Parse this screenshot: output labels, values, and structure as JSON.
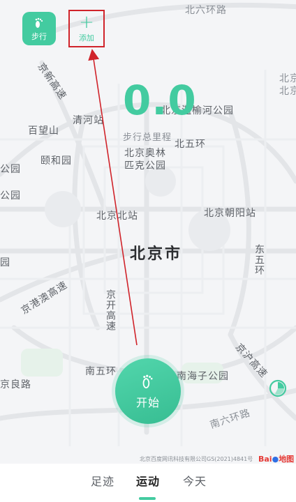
{
  "header": {
    "mode_label": "步行",
    "add_label": "添加"
  },
  "stats": {
    "distance": "0.0",
    "distance_label": "步行总里程"
  },
  "map": {
    "labels": {
      "north_6th_ring": "北六环路",
      "jingxin_expressway": "京新高速",
      "qinghe": "清河站",
      "baiwangshan": "百望山",
      "yiheyuan": "颐和园",
      "park_left1": "公园",
      "park_left2": "公园",
      "wenyu_park": "北京温榆河公园",
      "north_5th_ring": "北五环",
      "olympic_park_1": "北京奥林",
      "olympic_park_2": "匹克公园",
      "beijing_north_station": "北京北站",
      "chaoyang_station": "北京朝阳站",
      "city": "北京市",
      "east_5th_ring": "东五环",
      "jinggangao": "京港澳高速",
      "jingkai": "京开高速",
      "jinghu": "京沪高速",
      "south_5th_ring": "南五环",
      "nanhaizi_park": "南海子公园",
      "jingliang": "京良路",
      "south_6th_ring": "南六环路",
      "beijing_intl": "北京国际",
      "right_top_1": "北京",
      "left_garden": "园"
    },
    "copyright": "北京百度网讯科技有限公司GS(2021)4841号",
    "logo_part1": "Bai",
    "logo_part2": "地图"
  },
  "start_button": {
    "label": "开始"
  },
  "bottom_nav": {
    "tabs": [
      "足迹",
      "运动",
      "今天"
    ],
    "active_index": 1
  },
  "colors": {
    "accent": "#43cba0",
    "annotation": "#d0232a"
  }
}
